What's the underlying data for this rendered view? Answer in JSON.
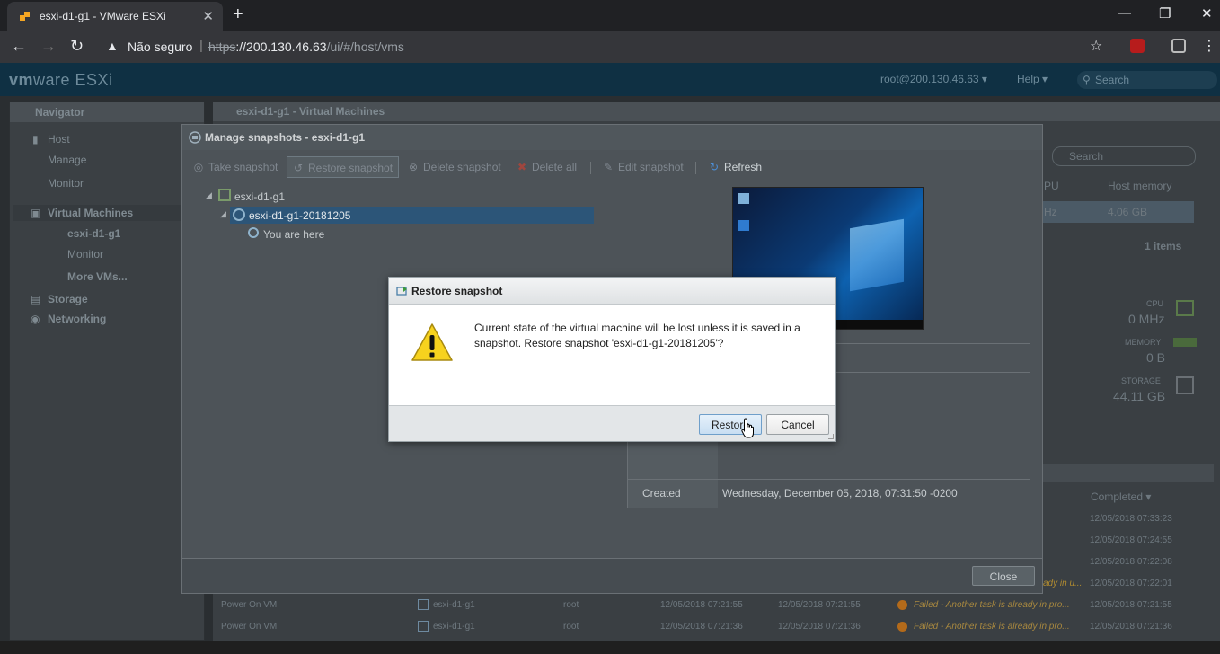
{
  "browser": {
    "tab_title": "esxi-d1-g1 - VMware ESXi",
    "tab_close": "✕",
    "new_tab": "+",
    "security_label": "Não seguro",
    "url_scheme": "https",
    "url_host": "://200.130.46.63",
    "url_path": "/ui/#/host/vms",
    "window_controls": [
      "—",
      "❐",
      "✕"
    ]
  },
  "esxi_header": {
    "logo_vm": "vm",
    "logo_ware": "ware",
    "logo_product": "ESXi",
    "user": "root@200.130.46.63 ▾",
    "help": "Help ▾",
    "search_placeholder": "Search"
  },
  "navigator": {
    "title": "Navigator",
    "items": [
      {
        "label": "Host"
      },
      {
        "label": "Manage"
      },
      {
        "label": "Monitor"
      },
      {
        "label": "Virtual Machines"
      },
      {
        "label": "esxi-d1-g1"
      },
      {
        "label": "Monitor"
      },
      {
        "label": "More VMs..."
      },
      {
        "label": "Storage"
      },
      {
        "label": "Networking"
      }
    ]
  },
  "vm_panel": {
    "title": "esxi-d1-g1 - Virtual Machines",
    "search_placeholder": "Search",
    "col_cpu": "PU",
    "col_host_memory": "Host memory",
    "row_cpu": "Hz",
    "row_host_memory": "4.06 GB",
    "items_count": "1 items",
    "cpu_label": "CPU",
    "cpu_value": "0 MHz",
    "memory_label": "MEMORY",
    "memory_value": "0 B",
    "storage_label": "STORAGE",
    "storage_value": "44.11 GB",
    "completed_col": "Completed ▾",
    "completed_times": [
      "12/05/2018 07:33:23",
      "12/05/2018 07:24:55",
      "12/05/2018 07:22:08",
      "12/05/2018 07:22:01"
    ],
    "task_rows": [
      {
        "task": "Power On VM",
        "target": "esxi-d1-g1",
        "initiator": "root",
        "queued": "12/05/2018 07:21:55",
        "started": "12/05/2018 07:21:55",
        "result": "Failed - Another task is already in pro...",
        "completed": "12/05/2018 07:21:55"
      },
      {
        "task": "Power On VM",
        "target": "esxi-d1-g1",
        "initiator": "root",
        "queued": "12/05/2018 07:21:36",
        "started": "12/05/2018 07:21:36",
        "result": "Failed - Another task is already in pro...",
        "completed": "12/05/2018 07:21:36"
      }
    ],
    "partial_result": "ady in u..."
  },
  "snapshots_modal": {
    "title": "Manage snapshots - esxi-d1-g1",
    "toolbar": {
      "take": "Take snapshot",
      "restore": "Restore snapshot",
      "delete": "Delete snapshot",
      "delete_all": "Delete all",
      "edit": "Edit snapshot",
      "refresh": "Refresh"
    },
    "tree": {
      "vm": "esxi-d1-g1",
      "snapshot": "esxi-d1-g1-20181205",
      "you_are_here": "You are here"
    },
    "details": {
      "created_label": "Created",
      "created_value": "Wednesday, December 05, 2018, 07:31:50 -0200"
    },
    "close_label": "Close"
  },
  "restore_dialog": {
    "title": "Restore snapshot",
    "message": "Current state of the virtual machine will be lost unless it is saved in a snapshot. Restore snapshot 'esxi-d1-g1-20181205'?",
    "restore_label": "Restore",
    "cancel_label": "Cancel"
  },
  "colors": {
    "esxi_header_bg": "#0f3043",
    "selected_tree_bg": "#2c5578",
    "dialog_button_blue": "#c8def2"
  }
}
